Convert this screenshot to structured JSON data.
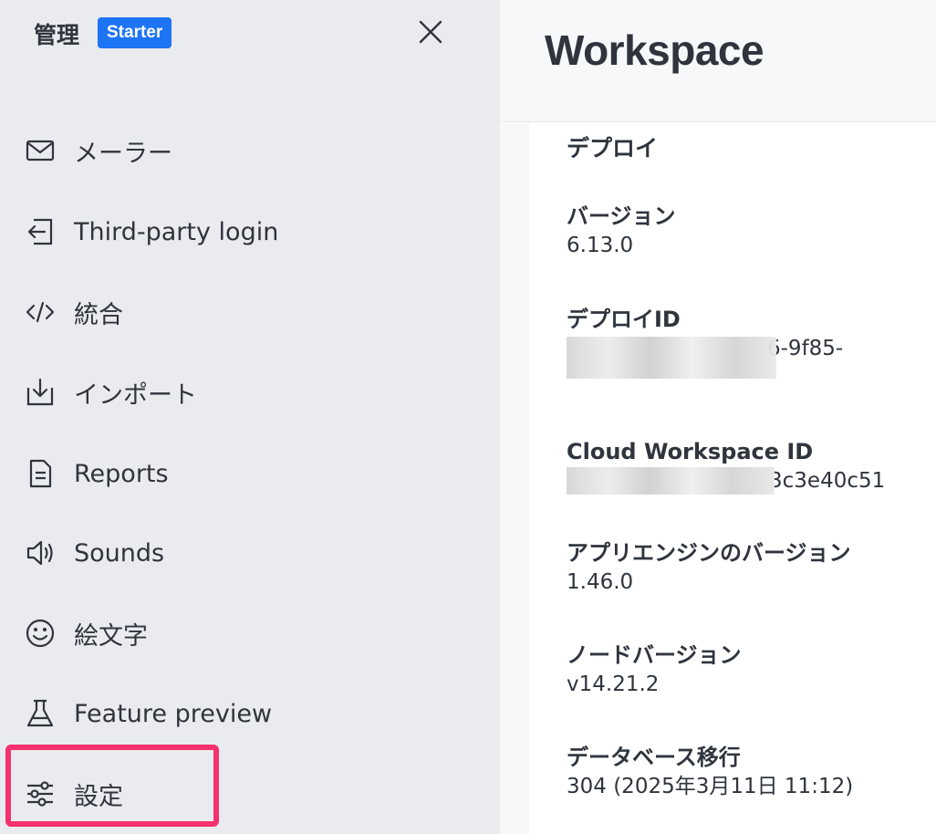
{
  "sidebar": {
    "title": "管理",
    "badge": "Starter",
    "items": [
      {
        "label": "メーラー",
        "icon": "mail-icon"
      },
      {
        "label": "Third-party login",
        "icon": "login-icon"
      },
      {
        "label": "統合",
        "icon": "code-icon"
      },
      {
        "label": "インポート",
        "icon": "import-icon"
      },
      {
        "label": "Reports",
        "icon": "document-icon"
      },
      {
        "label": "Sounds",
        "icon": "speaker-icon"
      },
      {
        "label": "絵文字",
        "icon": "emoji-icon"
      },
      {
        "label": "Feature preview",
        "icon": "flask-icon"
      },
      {
        "label": "設定",
        "icon": "sliders-icon"
      }
    ]
  },
  "main": {
    "title": "Workspace",
    "section_title": "デプロイ",
    "fields": [
      {
        "label": "バージョン",
        "value": "6.13.0"
      },
      {
        "label": "デプロイID",
        "value": "6-9f85-"
      },
      {
        "label": "Cloud Workspace ID",
        "value": "3c3e40c51"
      },
      {
        "label": "アプリエンジンのバージョン",
        "value": "1.46.0"
      },
      {
        "label": "ノードバージョン",
        "value": "v14.21.2"
      },
      {
        "label": "データベース移行",
        "value": "304 (2025年3月11日 11:12)"
      }
    ]
  },
  "colors": {
    "badge": "#1d74f5",
    "highlight": "#f5316f",
    "sidebar_bg": "#eaebee"
  }
}
